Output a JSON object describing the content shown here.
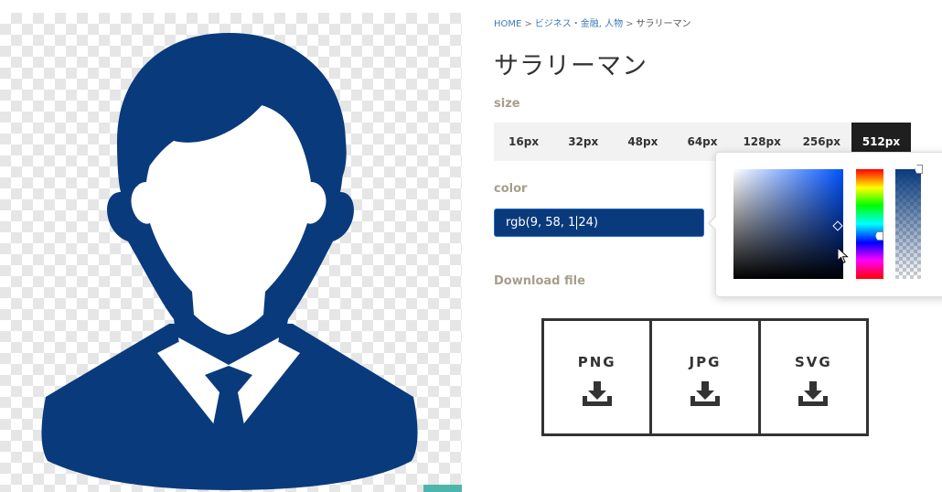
{
  "breadcrumb": {
    "home": "HOME",
    "separator": ">",
    "category": "ビジネス・金融, 人物",
    "current": "サラリーマン"
  },
  "page_title": "サラリーマン",
  "size_section": {
    "label": "size",
    "options": [
      "16px",
      "32px",
      "48px",
      "64px",
      "128px",
      "256px",
      "512px"
    ],
    "selected": "512px"
  },
  "color_section": {
    "label": "color",
    "value_before_caret": "rgb(9, 58, 1",
    "value_after_caret": "24)",
    "icon_color": "#093a7c"
  },
  "download_section": {
    "label": "Download file",
    "formats": [
      "PNG",
      "JPG",
      "SVG"
    ]
  },
  "icons": {
    "preview": "businessman-silhouette-icon",
    "download": "download-icon"
  },
  "colors": {
    "accent": "#093a7c",
    "teal": "#4db6ac",
    "label": "#a59f8a",
    "link": "#3c7ab8"
  }
}
